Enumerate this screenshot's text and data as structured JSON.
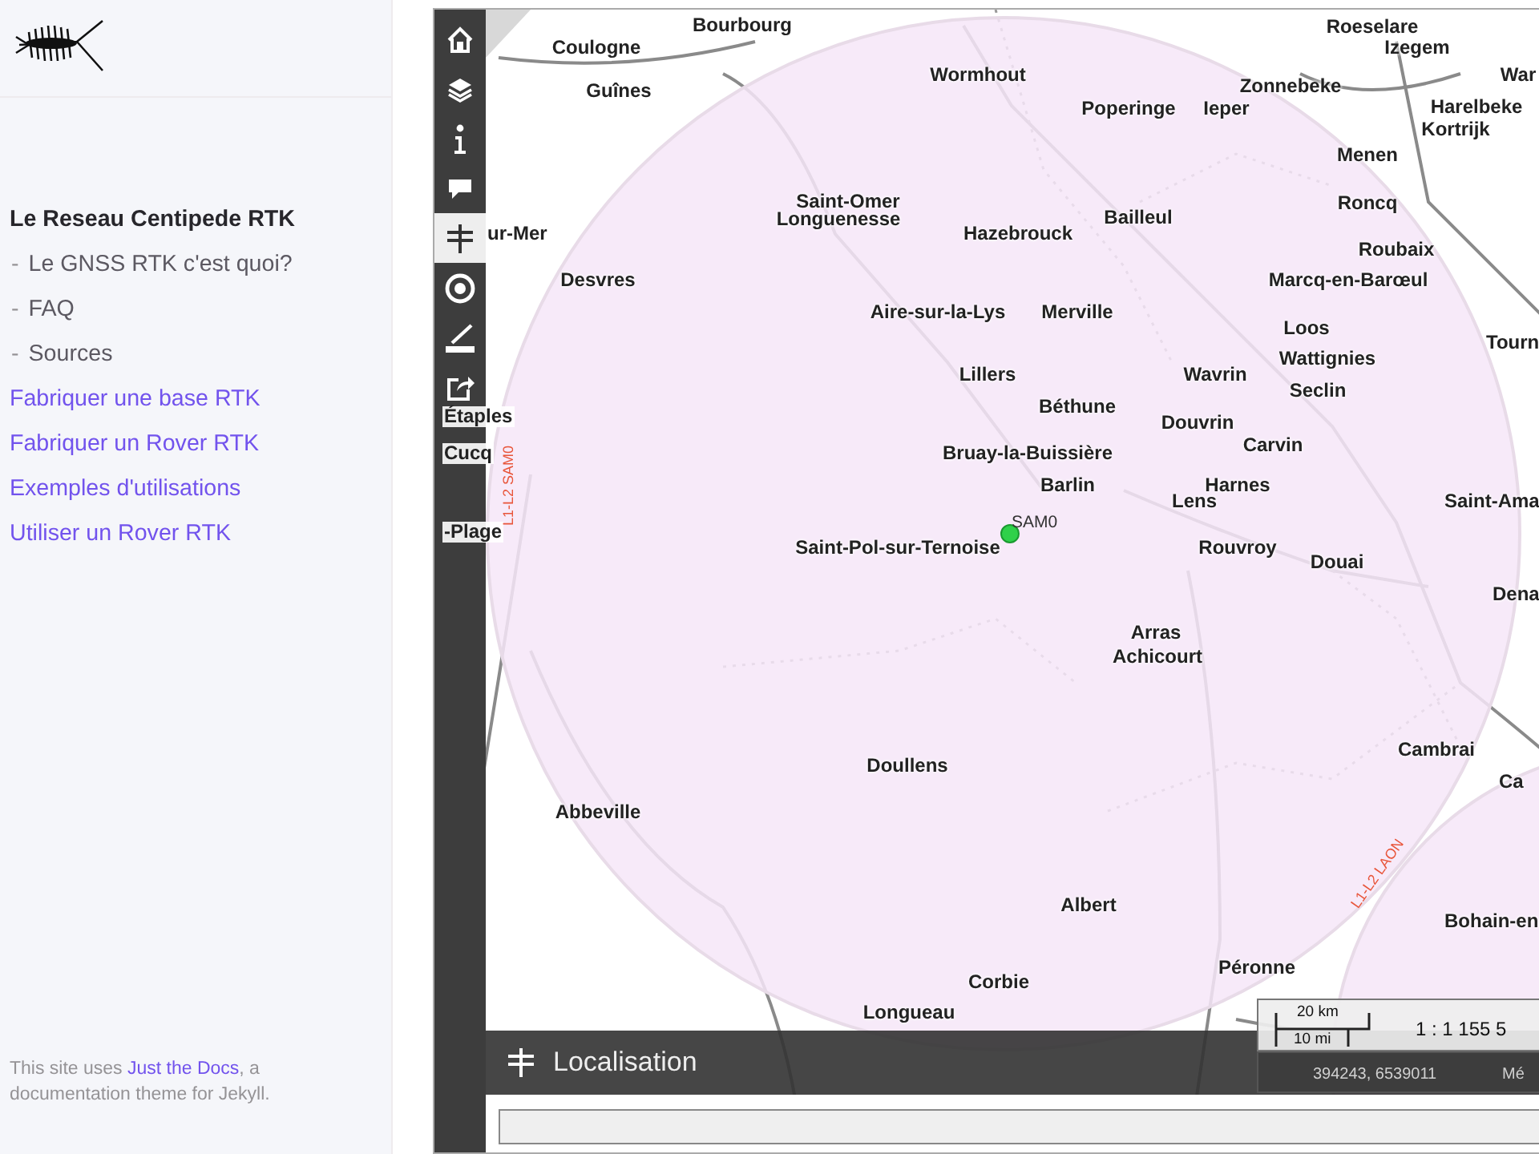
{
  "sidebar": {
    "nav": [
      {
        "label": "Le Reseau Centipede RTK",
        "kind": "heading"
      },
      {
        "label": "Le GNSS RTK c'est quoi?",
        "kind": "sub",
        "bullet": "-"
      },
      {
        "label": "FAQ",
        "kind": "sub",
        "bullet": "-"
      },
      {
        "label": "Sources",
        "kind": "sub",
        "bullet": "-"
      },
      {
        "label": "Fabriquer une base RTK",
        "kind": "link"
      },
      {
        "label": "Fabriquer un Rover RTK",
        "kind": "link"
      },
      {
        "label": "Exemples d'utilisations",
        "kind": "link"
      },
      {
        "label": "Utiliser un Rover RTK",
        "kind": "link"
      }
    ],
    "footer": {
      "before": "This site uses ",
      "link": "Just the Docs",
      "after": ", a documentation theme for Jekyll."
    }
  },
  "map": {
    "toolbar": [
      {
        "kind": "home",
        "selected": false
      },
      {
        "kind": "layers",
        "selected": false
      },
      {
        "kind": "info",
        "selected": false
      },
      {
        "kind": "comment",
        "selected": false
      },
      {
        "kind": "signpost",
        "selected": true
      },
      {
        "kind": "target",
        "selected": false
      },
      {
        "kind": "ruler",
        "selected": false
      },
      {
        "kind": "share",
        "selected": false
      }
    ],
    "places": [
      "Bourbourg",
      "Roeselare",
      "Coulogne",
      "Guînes",
      "Wormhout",
      "Izegem",
      "Zonnebeke",
      "War",
      "Poperinge",
      "Ieper",
      "Harelbeke",
      "Kortrijk",
      "Menen",
      "Roncq",
      "Saint-Omer",
      "Longuenesse",
      "Hazebrouck",
      "Bailleul",
      "ur-Mer",
      "Roubaix",
      "Desvres",
      "Marcq-en-Barœul",
      "Aire-sur-la-Lys",
      "Merville",
      "Loos",
      "Tourn",
      "Wattignies",
      "Wavrin",
      "Seclin",
      "Lillers",
      "Béthune",
      "Étaples",
      "Douvrin",
      "Carvin",
      "Cucq",
      "Bruay-la-Buissière",
      "Barlin",
      "Harnes",
      "Lens",
      "Saint-Ama",
      "-Plage",
      "Saint-Pol-sur-Ternoise",
      "Rouvroy",
      "Douai",
      "Dena",
      "Arras",
      "Achicourt",
      "Cambrai",
      "Doullens",
      "Ca",
      "Abbeville",
      "Albert",
      "Bohain-en",
      "Péronne",
      "Corbie",
      "Longueau"
    ],
    "routes": [
      "L1-L2 SAM0",
      "L1-L2 LAON"
    ],
    "marker": {
      "label": "SAM0"
    },
    "scale": {
      "metric": "20 km",
      "imperial": "10 mi",
      "ratio": "1 : 1 155 5"
    },
    "coordinates": "394243, 6539011",
    "projection": "Mé",
    "panel": {
      "title": "Localisation"
    }
  }
}
